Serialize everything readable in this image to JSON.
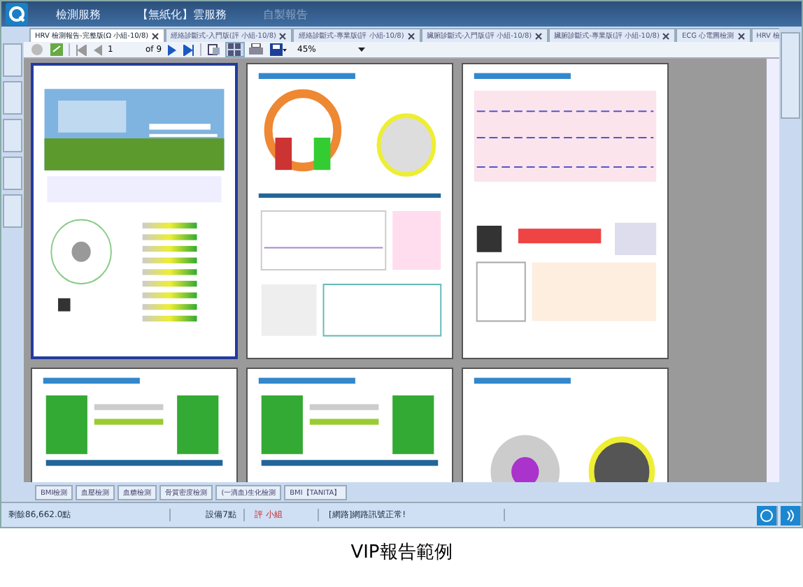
{
  "menu": [
    {
      "label": "檢測服務",
      "disabled": false
    },
    {
      "label": "【無紙化】雲服務",
      "disabled": false
    },
    {
      "label": "自製報告",
      "disabled": true
    }
  ],
  "tabs": [
    {
      "label": "HRV 檢測報告-完整版(Ω 小組-10/8)",
      "selected": true
    },
    {
      "label": "經絡診斷式-入門版(評 小組-10/8)",
      "selected": false
    },
    {
      "label": "經絡診斷式-專業版(評 小組-10/8)",
      "selected": false
    },
    {
      "label": "臟腑診斷式-入門版(評 小組-10/8)",
      "selected": false
    },
    {
      "label": "臟腑診斷式-專業版(評 小組-10/8)",
      "selected": false
    },
    {
      "label": "ECG 心電圖檢測",
      "selected": false
    },
    {
      "label": "HRV 檢",
      "selected": false
    }
  ],
  "toolbar": {
    "page": "1",
    "of": "of 9",
    "zoom": "45%"
  },
  "pages": [
    {
      "kind": "cover",
      "selected": true
    },
    {
      "kind": "chart",
      "selected": false
    },
    {
      "kind": "ecg",
      "selected": false
    },
    {
      "kind": "bars",
      "selected": false
    },
    {
      "kind": "bars",
      "selected": false
    },
    {
      "kind": "wheel",
      "selected": false
    }
  ],
  "bottom_tabs": [
    {
      "label": "BMI檢測"
    },
    {
      "label": "血壓檢測"
    },
    {
      "label": "血糖檢測"
    },
    {
      "label": "骨質密度檢測"
    },
    {
      "label": "(一滴血)生化檢測"
    },
    {
      "label": "BMI【TANITA】"
    }
  ],
  "status_bar": {
    "points": "剩餘86,662.0點",
    "device": "設備7點",
    "user": "評 小組",
    "network": "[網路]網路訊號正常!"
  },
  "caption": "VIP報告範例"
}
